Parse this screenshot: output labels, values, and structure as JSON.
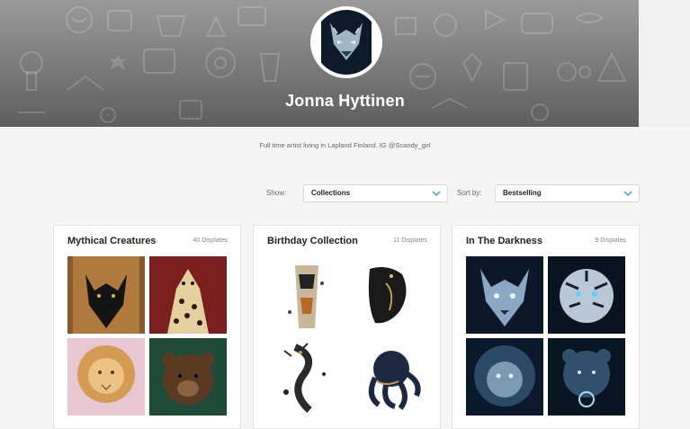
{
  "profile": {
    "name": "Jonna Hyttinen",
    "bio": "Full time artist living in Lapland Finland. IG @Scandy_girl"
  },
  "filters": {
    "show_label": "Show:",
    "show_value": "Collections",
    "sort_label": "Sort by:",
    "sort_value": "Bestselling"
  },
  "collections": [
    {
      "title": "Mythical Creatures",
      "count": "40 Displates",
      "thumbs": [
        "black-wolf-art",
        "cheetah-art",
        "lion-art",
        "bear-art"
      ]
    },
    {
      "title": "Birthday Collection",
      "count": "11 Displates",
      "thumbs": [
        "calico-cat-art",
        "black-cat-art",
        "dragon-art",
        "octopus-art"
      ]
    },
    {
      "title": "In The Darkness",
      "count": "9 Displates",
      "thumbs": [
        "dark-wolf-art",
        "dark-tiger-art",
        "dark-lion-art",
        "dark-bear-art"
      ]
    }
  ],
  "colors": {
    "accent": "#2a9fd6",
    "banner_dark": "#5e5e5e",
    "card_border": "#e3e3e3"
  }
}
